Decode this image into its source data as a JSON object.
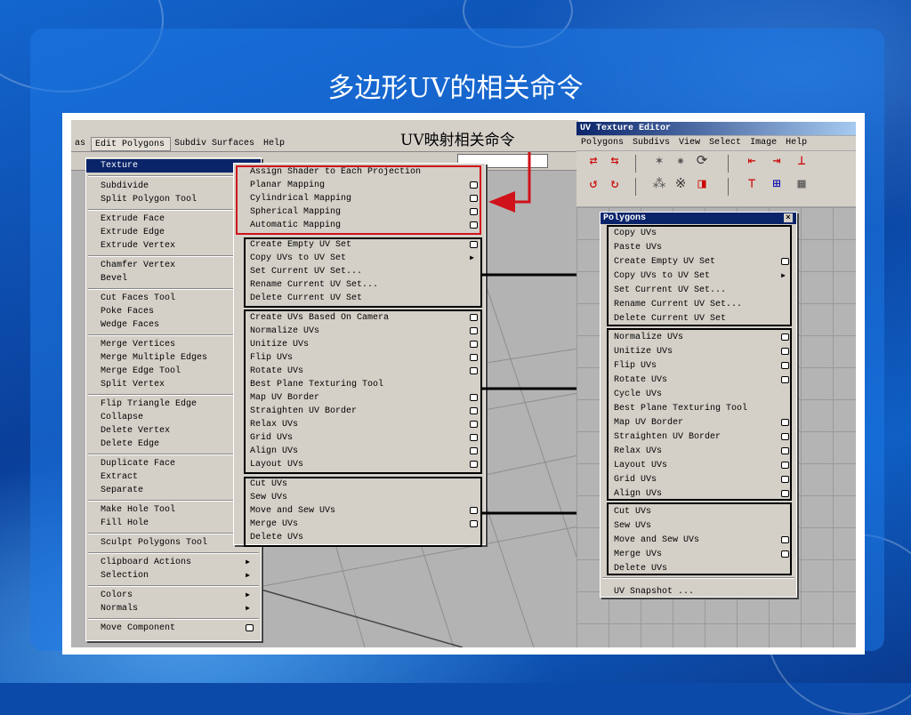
{
  "slide_title": "多边形UV的相关命令",
  "callout": "UV映射相关命令",
  "maya_menubar": [
    "as",
    "Edit Polygons",
    "Subdiv Surfaces",
    "Help"
  ],
  "main_menu": [
    {
      "label": "Texture",
      "arrow": "▶"
    },
    {
      "label": "Subdivide"
    },
    {
      "label": "Split Polygon Tool"
    },
    {
      "label": "Extrude Face"
    },
    {
      "label": "Extrude Edge"
    },
    {
      "label": "Extrude Vertex"
    },
    {
      "label": "Chamfer Vertex"
    },
    {
      "label": "Bevel"
    },
    {
      "label": "Cut Faces Tool"
    },
    {
      "label": "Poke Faces"
    },
    {
      "label": "Wedge Faces"
    },
    {
      "label": "Merge Vertices"
    },
    {
      "label": "Merge Multiple Edges"
    },
    {
      "label": "Merge Edge Tool"
    },
    {
      "label": "Split Vertex"
    },
    {
      "label": "Flip Triangle Edge"
    },
    {
      "label": "Collapse"
    },
    {
      "label": "Delete Vertex"
    },
    {
      "label": "Delete Edge"
    },
    {
      "label": "Duplicate Face"
    },
    {
      "label": "Extract"
    },
    {
      "label": "Separate"
    },
    {
      "label": "Make Hole Tool"
    },
    {
      "label": "Fill Hole"
    },
    {
      "label": "Sculpt Polygons Tool"
    },
    {
      "label": "Clipboard Actions",
      "arrow": "▶"
    },
    {
      "label": "Selection",
      "arrow": "▶"
    },
    {
      "label": "Colors",
      "arrow": "▶"
    },
    {
      "label": "Normals",
      "arrow": "▶"
    },
    {
      "label": "Move Component",
      "box": true
    }
  ],
  "texture_submenu": [
    {
      "label": "Assign Shader to Each Projection"
    },
    {
      "label": "Planar Mapping",
      "box": true
    },
    {
      "label": "Cylindrical Mapping",
      "box": true
    },
    {
      "label": "Spherical Mapping",
      "box": true
    },
    {
      "label": "Automatic Mapping",
      "box": true
    },
    {
      "label": "Create Empty UV Set",
      "box": true
    },
    {
      "label": "Copy UVs to UV Set",
      "arrow": "▶"
    },
    {
      "label": "Set Current UV Set..."
    },
    {
      "label": "Rename Current UV Set..."
    },
    {
      "label": "Delete Current UV Set"
    },
    {
      "label": "Create UVs Based On Camera",
      "box": true
    },
    {
      "label": "Normalize UVs",
      "box": true
    },
    {
      "label": "Unitize UVs",
      "box": true
    },
    {
      "label": "Flip UVs",
      "box": true
    },
    {
      "label": "Rotate UVs",
      "box": true
    },
    {
      "label": "Best Plane Texturing Tool"
    },
    {
      "label": "Map UV Border",
      "box": true
    },
    {
      "label": "Straighten UV Border",
      "box": true
    },
    {
      "label": "Relax UVs",
      "box": true
    },
    {
      "label": "Grid UVs",
      "box": true
    },
    {
      "label": "Align UVs",
      "box": true
    },
    {
      "label": "Layout UVs",
      "box": true
    },
    {
      "label": "Cut UVs"
    },
    {
      "label": "Sew UVs"
    },
    {
      "label": "Move and Sew UVs",
      "box": true
    },
    {
      "label": "Merge UVs",
      "box": true
    },
    {
      "label": "Delete UVs"
    }
  ],
  "uv_editor": {
    "title": "UV Texture Editor",
    "menubar": [
      "Polygons",
      "Subdivs",
      "View",
      "Select",
      "Image",
      "Help"
    ],
    "toolbar_icons": [
      "move-uv-icon",
      "rotate-uv-icon",
      "flip-u-icon",
      "flip-v-icon",
      "cycle-icon",
      "align-left-icon",
      "align-right-icon",
      "align-bottom-icon",
      "rotate-ccw-icon",
      "rotate-cw-icon",
      "sew-icon",
      "cut-icon",
      "unfold-icon",
      "align-top-icon",
      "grid-icon",
      "checker-icon"
    ],
    "popup_title": "Polygons",
    "popup_items": [
      {
        "label": "Copy UVs"
      },
      {
        "label": "Paste UVs"
      },
      {
        "label": "Create Empty UV Set",
        "box": true
      },
      {
        "label": "Copy UVs to UV Set",
        "arrow": "▶"
      },
      {
        "label": "Set Current UV Set..."
      },
      {
        "label": "Rename Current UV Set..."
      },
      {
        "label": "Delete Current UV Set"
      },
      {
        "label": "Normalize UVs",
        "box": true
      },
      {
        "label": "Unitize UVs",
        "box": true
      },
      {
        "label": "Flip UVs",
        "box": true
      },
      {
        "label": "Rotate UVs",
        "box": true
      },
      {
        "label": "Cycle UVs"
      },
      {
        "label": "Best Plane Texturing Tool"
      },
      {
        "label": "Map UV Border",
        "box": true
      },
      {
        "label": "Straighten UV Border",
        "box": true
      },
      {
        "label": "Relax UVs",
        "box": true
      },
      {
        "label": "Layout UVs",
        "box": true
      },
      {
        "label": "Grid UVs",
        "box": true
      },
      {
        "label": "Align UVs",
        "box": true
      },
      {
        "label": "Cut UVs"
      },
      {
        "label": "Sew UVs"
      },
      {
        "label": "Move and Sew UVs",
        "box": true
      },
      {
        "label": "Merge UVs",
        "box": true
      },
      {
        "label": "Delete UVs"
      },
      {
        "label": "UV Snapshot ..."
      }
    ]
  },
  "colors": {
    "highlight": "#0a246a",
    "red_frame": "#d0121a",
    "menu_bg": "#d4d0c8"
  }
}
